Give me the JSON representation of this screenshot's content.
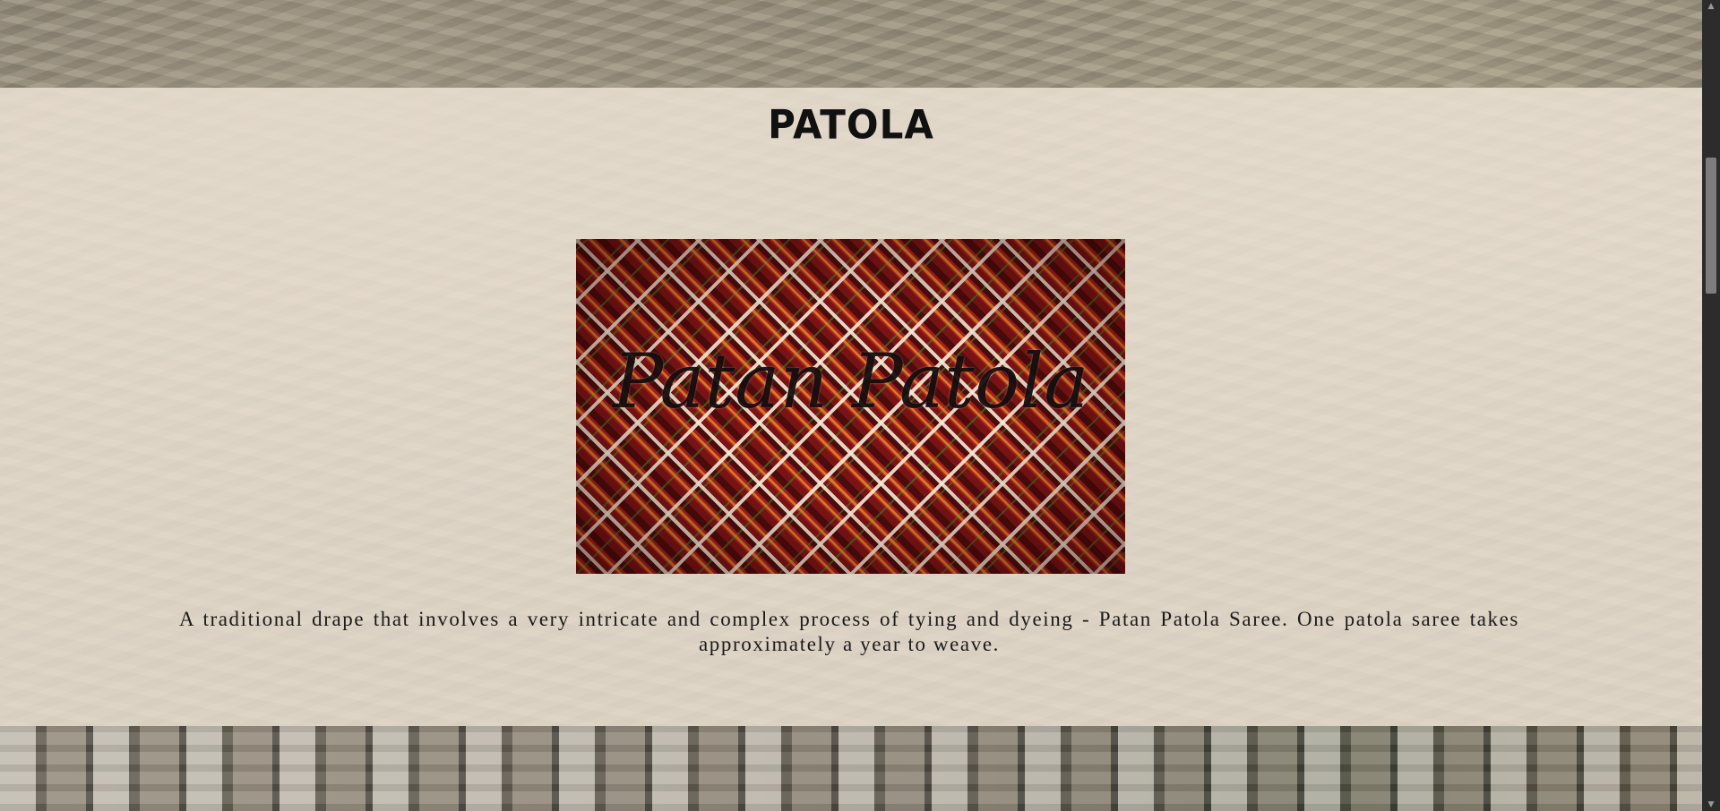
{
  "section": {
    "title": "PATOLA",
    "image_caption": "Patan Patola",
    "description": "A traditional drape that involves a very intricate and complex process of tying and dyeing - Patan Patola Saree. One patola saree takes approximately a year to weave."
  },
  "icons": {
    "scroll_up": "triangle-up-icon",
    "scroll_down": "triangle-down-icon"
  },
  "colors": {
    "panel_overlay": "#ece2d4",
    "title_text": "#111111",
    "scrollbar_track": "#2c2c2c",
    "scrollbar_thumb": "#7d7d7d"
  }
}
